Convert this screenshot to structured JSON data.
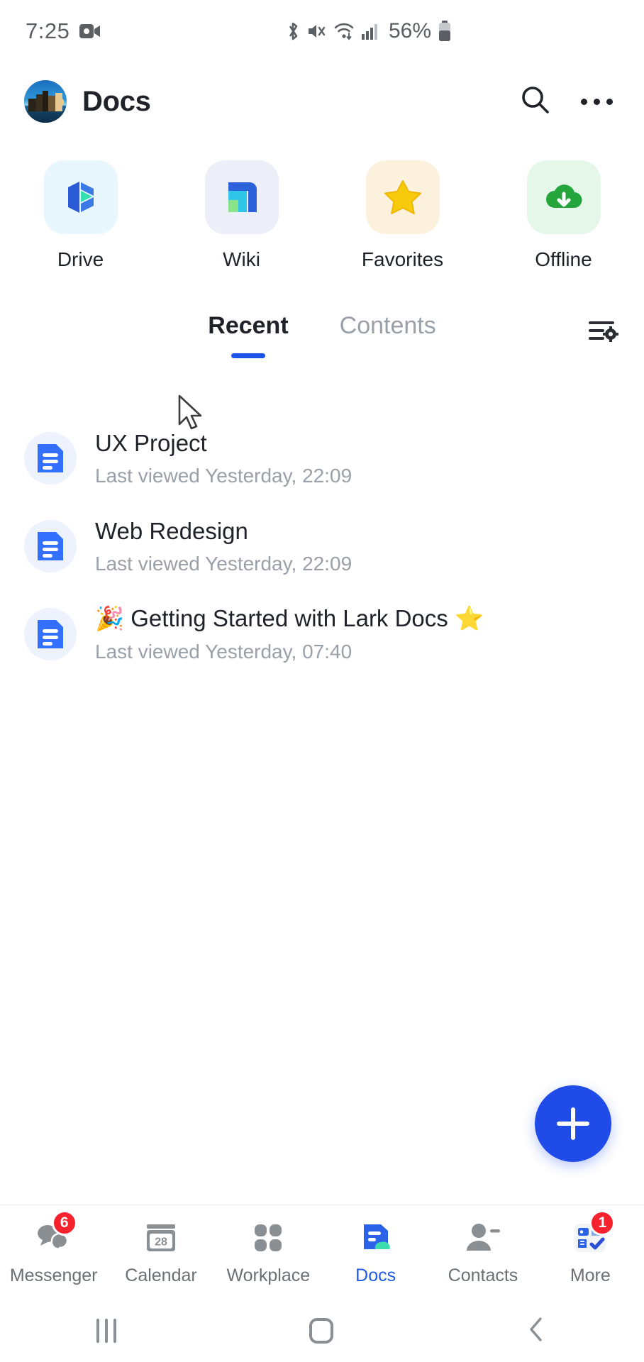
{
  "statusbar": {
    "time": "7:25",
    "battery_percent": "56%",
    "icons": [
      "screen-record-icon",
      "bluetooth-icon",
      "mute-icon",
      "wifi-icon",
      "cellular-signal-icon",
      "battery-icon"
    ]
  },
  "header": {
    "title": "Docs",
    "avatar_name": "user-avatar",
    "search_label": "search-icon",
    "more_label": "more-options-icon"
  },
  "shortcuts": [
    {
      "label": "Drive",
      "icon": "drive-icon",
      "tile_color": "#e8f6fd"
    },
    {
      "label": "Wiki",
      "icon": "wiki-icon",
      "tile_color": "#eceff8"
    },
    {
      "label": "Favorites",
      "icon": "star-icon",
      "tile_color": "#fbf1dc"
    },
    {
      "label": "Offline",
      "icon": "cloud-download-icon",
      "tile_color": "#e5f7e8"
    }
  ],
  "tabs": [
    {
      "label": "Recent",
      "active": true
    },
    {
      "label": "Contents",
      "active": false
    }
  ],
  "filter_icon": "sort-settings-icon",
  "documents": [
    {
      "title": "UX Project",
      "subtitle": "Last viewed Yesterday, 22:09"
    },
    {
      "title": "Web Redesign",
      "subtitle": "Last viewed Yesterday, 22:09"
    },
    {
      "title": "🎉 Getting Started with Lark Docs ⭐",
      "subtitle": "Last viewed Yesterday, 07:40"
    }
  ],
  "fab": {
    "label": "create-new-document",
    "icon": "plus-icon",
    "color": "#1f4ce8"
  },
  "bottom_nav": [
    {
      "label": "Messenger",
      "icon": "chat-bubbles-icon",
      "badge": "6",
      "active": false
    },
    {
      "label": "Calendar",
      "icon": "calendar-icon",
      "badge": "",
      "active": false,
      "day": "28"
    },
    {
      "label": "Workplace",
      "icon": "grid-apps-icon",
      "badge": "",
      "active": false
    },
    {
      "label": "Docs",
      "icon": "docs-icon",
      "badge": "",
      "active": true
    },
    {
      "label": "Contacts",
      "icon": "contacts-icon",
      "badge": "",
      "active": false
    },
    {
      "label": "More",
      "icon": "more-apps-icon",
      "badge": "1",
      "active": false
    }
  ],
  "android_nav": {
    "recents": "recents-button",
    "home": "home-button",
    "back": "back-button"
  },
  "accent_color": "#1f5be8",
  "badge_color": "#f5222d"
}
